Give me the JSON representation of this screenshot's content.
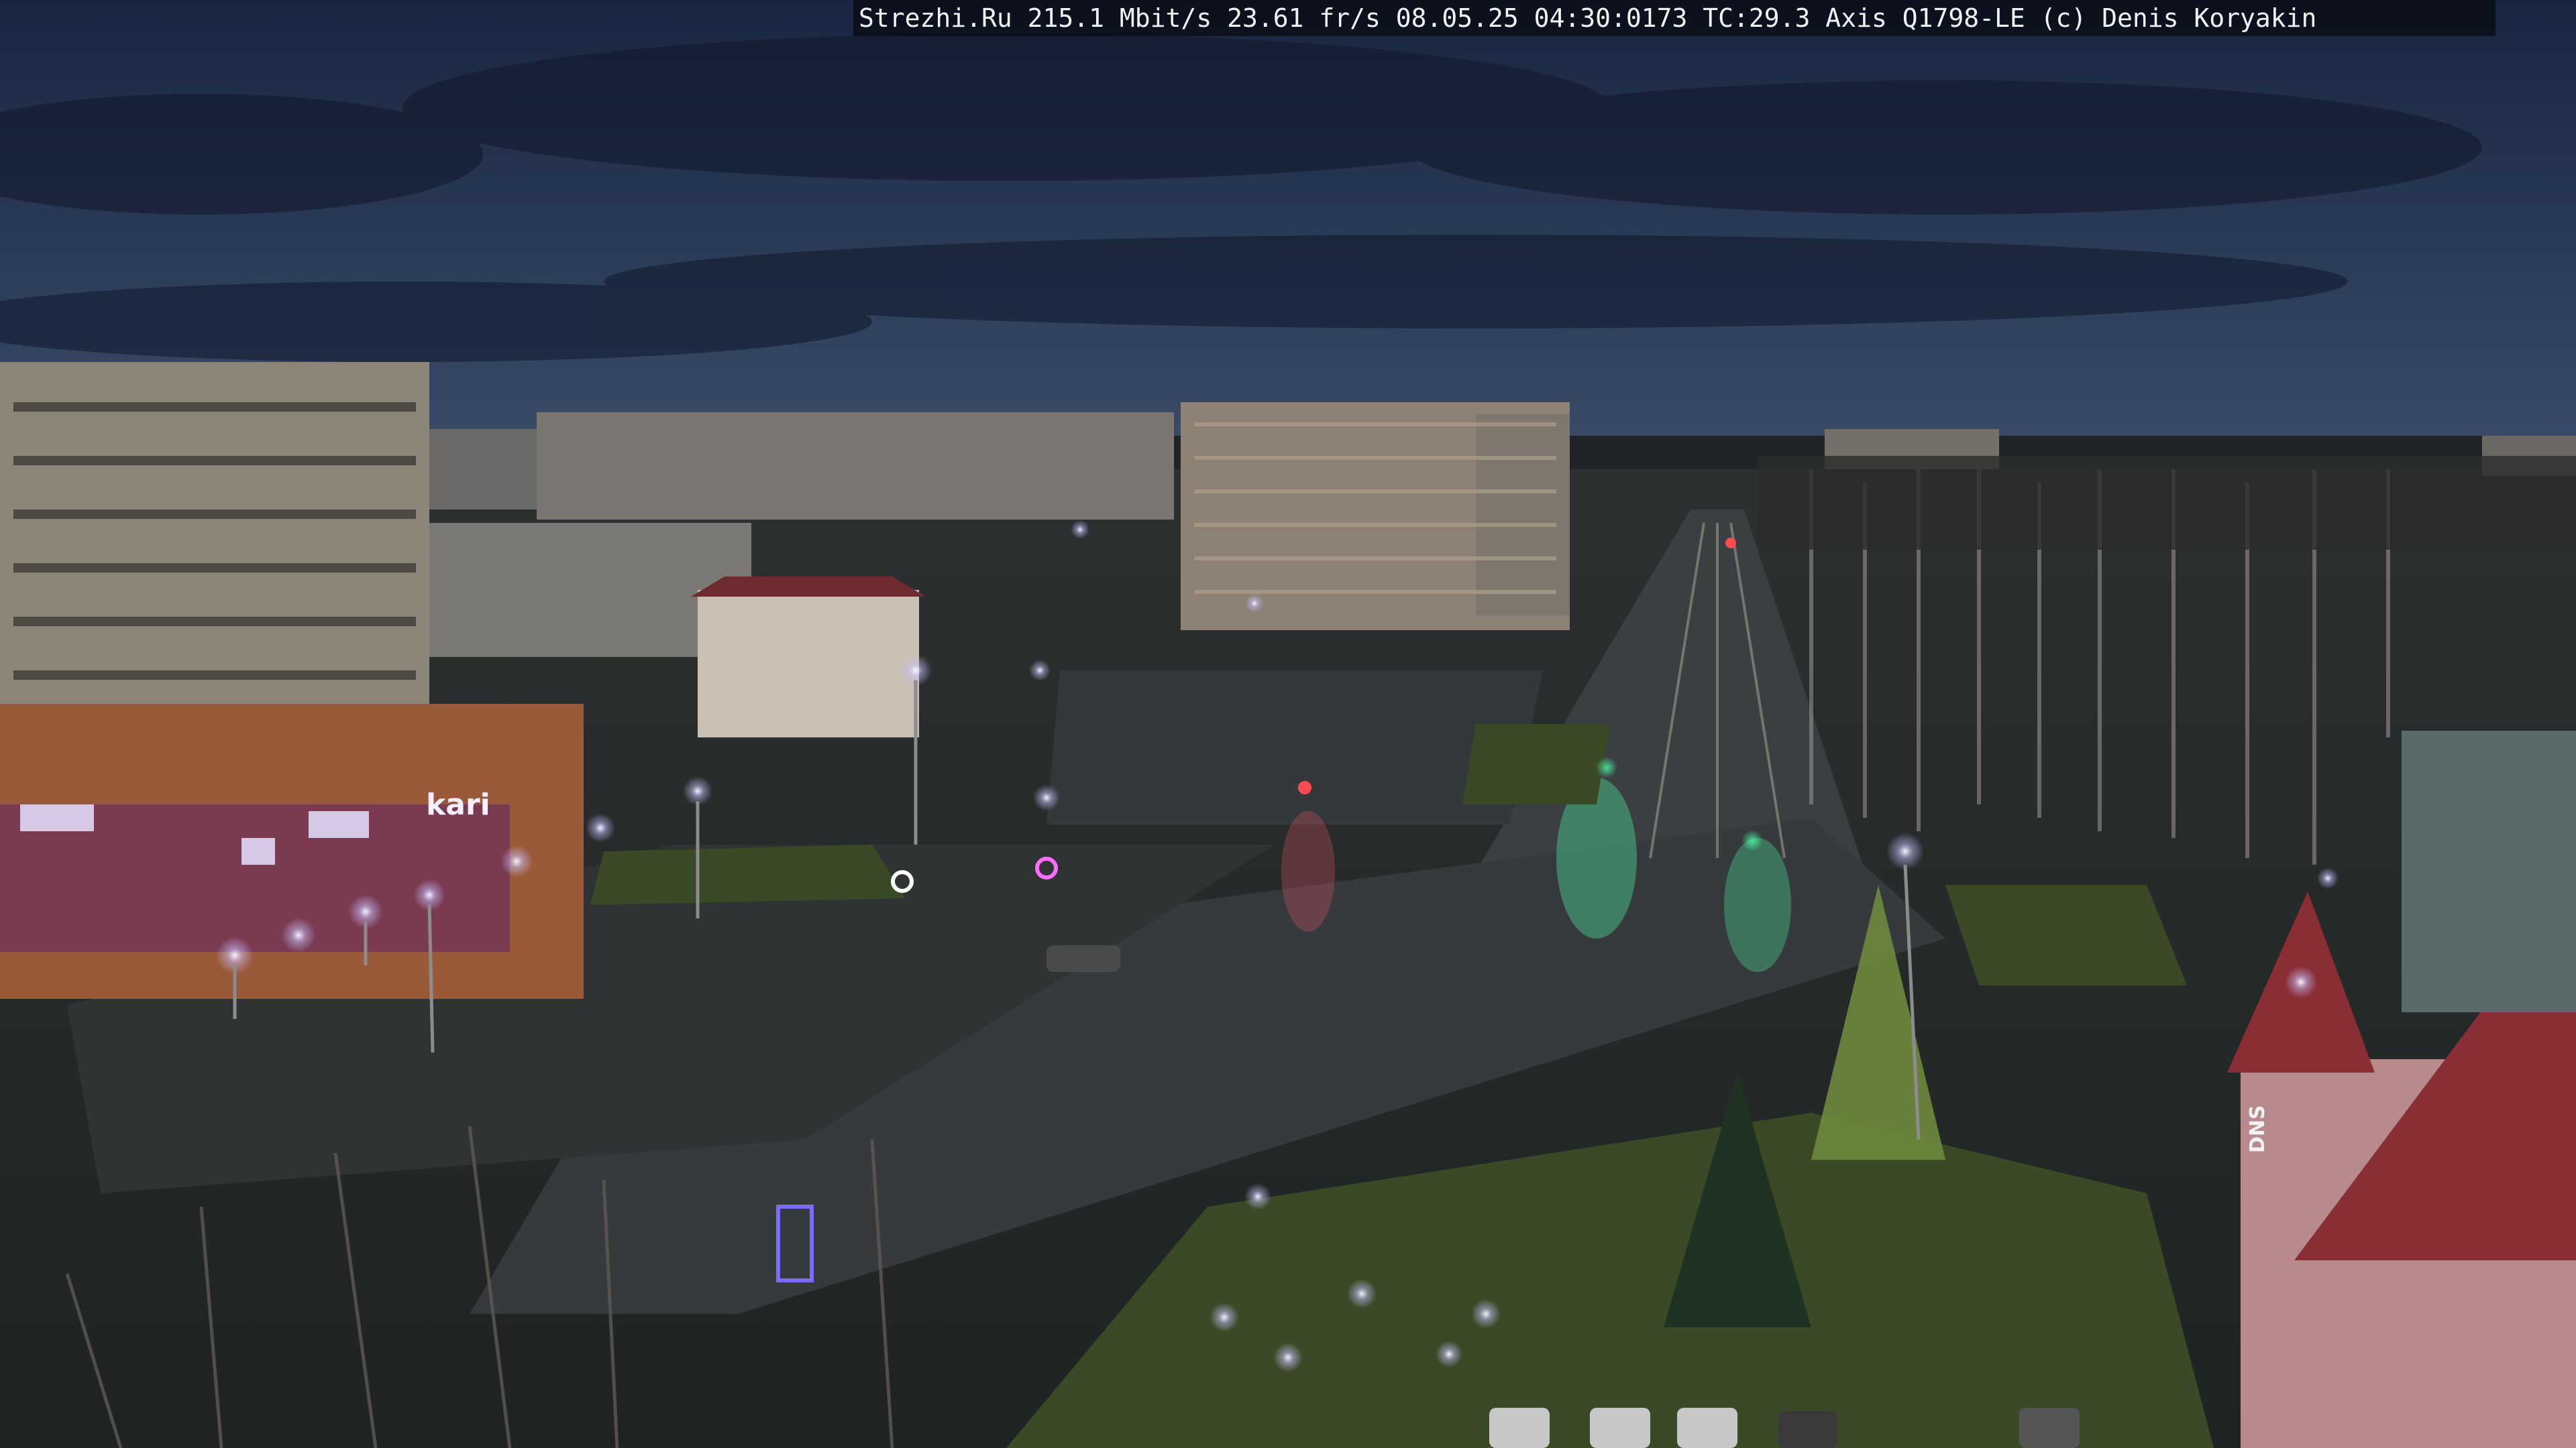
{
  "camera_overlay": {
    "text": "Strezhi.Ru 215.1 Mbit/s 23.61 fr/s 08.05.25 04:30:0173 TC:29.3  Axis Q1798-LE  (c) Denis Koryakin"
  },
  "signage": {
    "store_left": "kari",
    "store_right": "DNS"
  },
  "palette": {
    "sky_top": "#1b2740",
    "sky_mid": "#2e3d5c",
    "horizon": "#3a4a66",
    "road": "#3b3f42",
    "grass": "#3a4a26",
    "building_beige": "#8b8477",
    "building_pink": "#b98a8c",
    "roof_red": "#8a2e35",
    "lamp_light": "#f1e9ff"
  }
}
